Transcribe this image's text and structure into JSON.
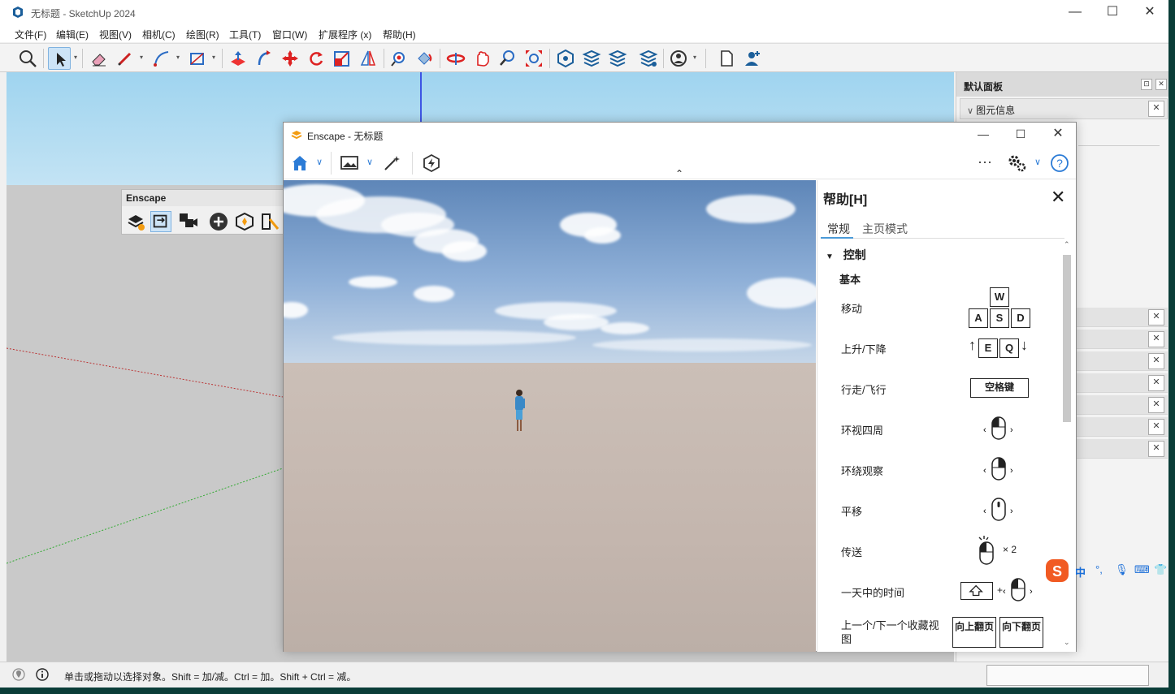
{
  "sketchup": {
    "title": "无标题 - SketchUp 2024",
    "menu": [
      "文件(F)",
      "编辑(E)",
      "视图(V)",
      "相机(C)",
      "绘图(R)",
      "工具(T)",
      "窗口(W)",
      "扩展程序 (x)",
      "帮助(H)"
    ],
    "status_message": "单击或拖动以选择对象。Shift = 加/减。Ctrl = 加。Shift + Ctrl = 减。"
  },
  "enscape_toolbar": {
    "title": "Enscape"
  },
  "tray": {
    "title": "默认面板",
    "entity_info": "图元信息"
  },
  "enscape_window": {
    "title": "Enscape - 无标题"
  },
  "help": {
    "title": "帮助[H]",
    "tabs": [
      "常规",
      "主页模式"
    ],
    "section": "控制",
    "subsection": "基本",
    "rows": [
      {
        "label": "移动"
      },
      {
        "label": "上升/下降"
      },
      {
        "label": "行走/飞行"
      },
      {
        "label": "环视四周"
      },
      {
        "label": "环绕观察"
      },
      {
        "label": "平移"
      },
      {
        "label": "传送"
      },
      {
        "label": "一天中的时间"
      },
      {
        "label": "上一个/下一个收藏视图"
      }
    ],
    "keys": {
      "w": "W",
      "a": "A",
      "s": "S",
      "d": "D",
      "e": "E",
      "q": "Q",
      "space": "空格键",
      "times2": "× 2",
      "pgup": "向上翻页",
      "pgdn": "向下翻页",
      "plus": "+"
    }
  },
  "ime": {
    "lang": "中"
  },
  "colors": {
    "accent": "#0078d4",
    "enscape_orange": "#f39c12",
    "help_tab_line": "#4a9ad8"
  }
}
